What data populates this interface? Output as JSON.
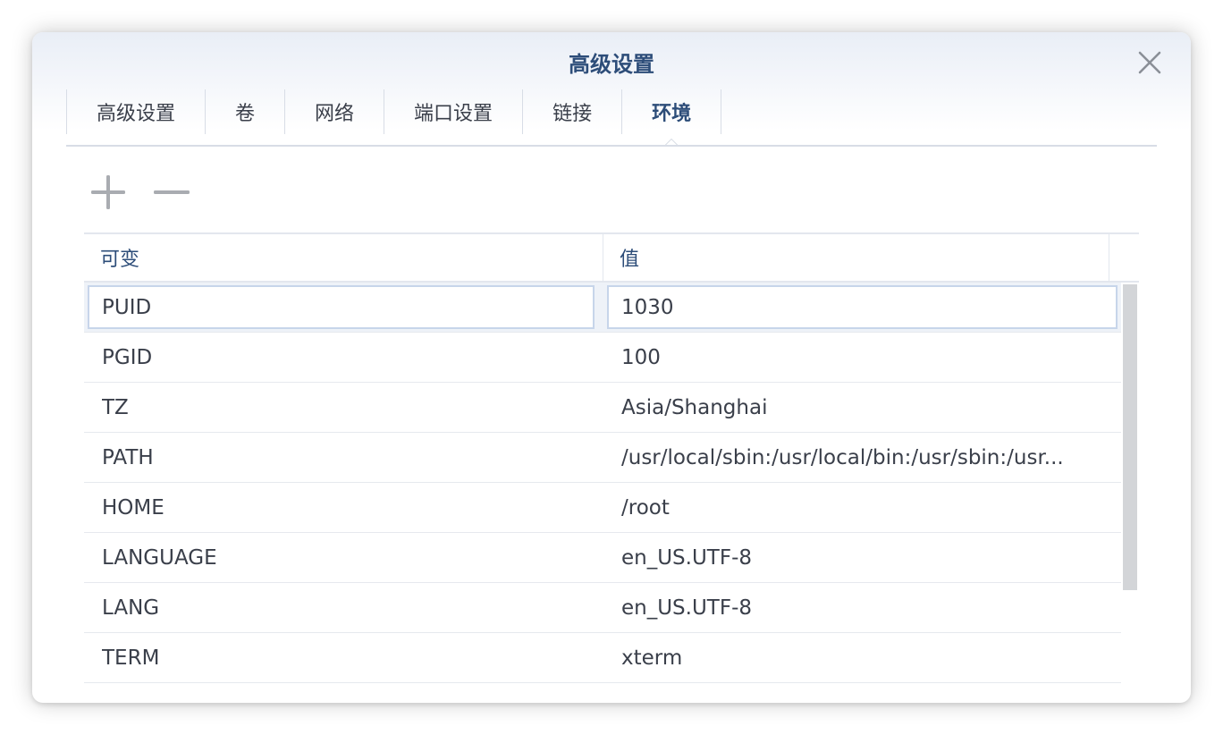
{
  "dialog": {
    "title": "高级设置",
    "close_icon": "close-icon"
  },
  "tabs": [
    {
      "label": "高级设置",
      "active": false
    },
    {
      "label": "卷",
      "active": false
    },
    {
      "label": "网络",
      "active": false
    },
    {
      "label": "端口设置",
      "active": false
    },
    {
      "label": "链接",
      "active": false
    },
    {
      "label": "环境",
      "active": true
    }
  ],
  "toolbar": {
    "add_icon": "plus-icon",
    "remove_icon": "minus-icon"
  },
  "table": {
    "columns": [
      "可变",
      "值"
    ],
    "selected_row": 0,
    "rows": [
      {
        "key": "PUID",
        "value": "1030"
      },
      {
        "key": "PGID",
        "value": "100"
      },
      {
        "key": "TZ",
        "value": "Asia/Shanghai"
      },
      {
        "key": "PATH",
        "value": "/usr/local/sbin:/usr/local/bin:/usr/sbin:/usr..."
      },
      {
        "key": "HOME",
        "value": "/root"
      },
      {
        "key": "LANGUAGE",
        "value": "en_US.UTF-8"
      },
      {
        "key": "LANG",
        "value": "en_US.UTF-8"
      },
      {
        "key": "TERM",
        "value": "xterm"
      }
    ]
  },
  "colors": {
    "accent": "#2d4d79",
    "text": "#3a3f4a",
    "border": "#e3e7ee",
    "selected_bg": "#eef2f8"
  }
}
